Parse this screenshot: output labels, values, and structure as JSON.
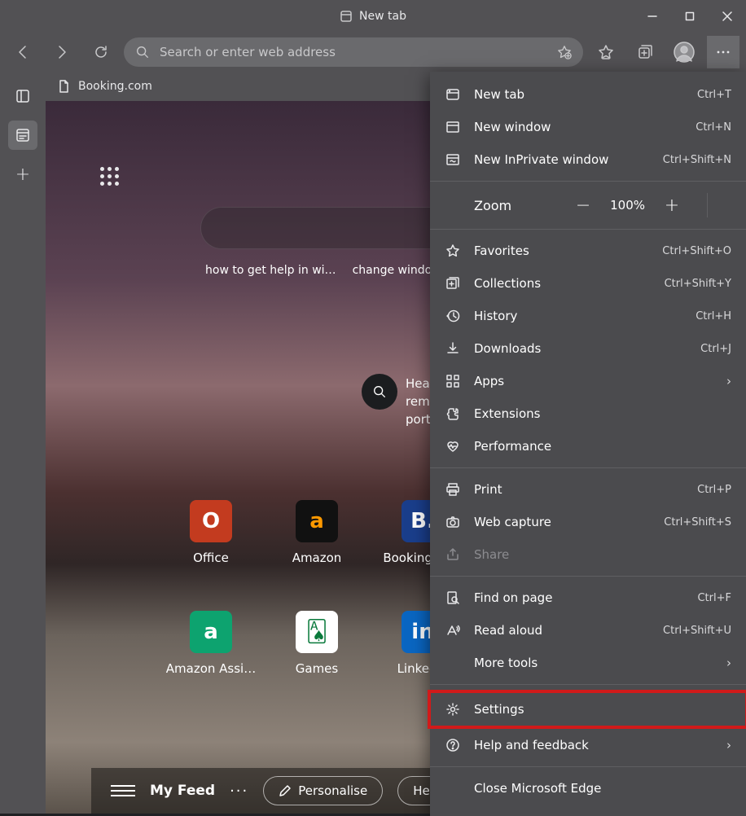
{
  "titlebar": {
    "title": "New tab"
  },
  "toolbar": {
    "addr_placeholder": "Search or enter web address"
  },
  "tab": {
    "label": "Booking.com"
  },
  "suggestions": [
    "how to get help in wi…",
    "change windows"
  ],
  "news": {
    "line1": "Hea",
    "line2": "rem",
    "line3": "port"
  },
  "tiles": [
    {
      "label": "Office",
      "glyph": "O",
      "bg": "#c33b1f"
    },
    {
      "label": "Amazon",
      "glyph": "a",
      "bg": "#111",
      "fg": "#ff9900"
    },
    {
      "label": "Booking.com",
      "glyph": "B.",
      "bg": "#1a3e8b"
    },
    {
      "label": "Amazon Assi…",
      "glyph": "a",
      "bg": "#0da36f"
    },
    {
      "label": "Games",
      "glyph": "🂡",
      "bg": "#fff",
      "fg": "#0a7a3c"
    },
    {
      "label": "LinkedIn",
      "glyph": "in",
      "bg": "#0a66c2"
    }
  ],
  "feed": {
    "title": "My Feed",
    "personalise": "Personalise",
    "headings": "Headings only"
  },
  "menu": {
    "new_tab": {
      "label": "New tab",
      "shortcut": "Ctrl+T"
    },
    "new_window": {
      "label": "New window",
      "shortcut": "Ctrl+N"
    },
    "inprivate": {
      "label": "New InPrivate window",
      "shortcut": "Ctrl+Shift+N"
    },
    "zoom": {
      "label": "Zoom",
      "value": "100%"
    },
    "favorites": {
      "label": "Favorites",
      "shortcut": "Ctrl+Shift+O"
    },
    "collections": {
      "label": "Collections",
      "shortcut": "Ctrl+Shift+Y"
    },
    "history": {
      "label": "History",
      "shortcut": "Ctrl+H"
    },
    "downloads": {
      "label": "Downloads",
      "shortcut": "Ctrl+J"
    },
    "apps": {
      "label": "Apps"
    },
    "extensions": {
      "label": "Extensions"
    },
    "performance": {
      "label": "Performance"
    },
    "print": {
      "label": "Print",
      "shortcut": "Ctrl+P"
    },
    "capture": {
      "label": "Web capture",
      "shortcut": "Ctrl+Shift+S"
    },
    "share": {
      "label": "Share"
    },
    "find": {
      "label": "Find on page",
      "shortcut": "Ctrl+F"
    },
    "aloud": {
      "label": "Read aloud",
      "shortcut": "Ctrl+Shift+U"
    },
    "more_tools": {
      "label": "More tools"
    },
    "settings": {
      "label": "Settings"
    },
    "help": {
      "label": "Help and feedback"
    },
    "close": {
      "label": "Close Microsoft Edge"
    }
  }
}
